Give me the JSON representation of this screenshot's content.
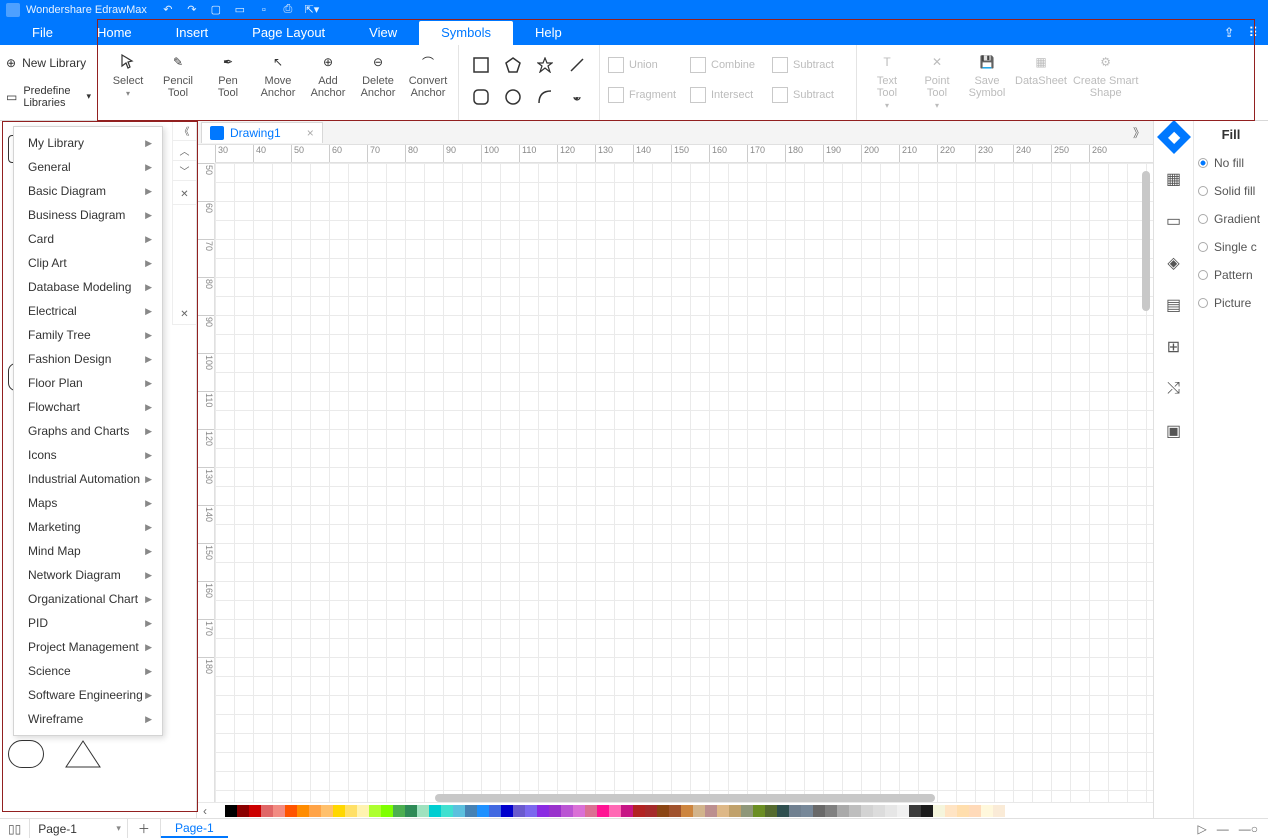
{
  "app": {
    "title": "Wondershare EdrawMax"
  },
  "menu": {
    "file": "File",
    "home": "Home",
    "insert": "Insert",
    "pageLayout": "Page Layout",
    "view": "View",
    "symbols": "Symbols",
    "help": "Help"
  },
  "ribbonLeft": {
    "newLibrary": "New Library",
    "predefine": "Predefine Libraries"
  },
  "ribbon": {
    "select": "Select",
    "pencil": "Pencil\nTool",
    "pen": "Pen\nTool",
    "moveAnchor": "Move\nAnchor",
    "addAnchor": "Add\nAnchor",
    "deleteAnchor": "Delete\nAnchor",
    "convertAnchor": "Convert\nAnchor",
    "union": "Union",
    "combine": "Combine",
    "subtract1": "Subtract",
    "fragment": "Fragment",
    "intersect": "Intersect",
    "subtract2": "Subtract",
    "textTool": "Text\nTool",
    "pointTool": "Point\nTool",
    "saveSymbol": "Save\nSymbol",
    "datasheet": "DataSheet",
    "smartShape": "Create Smart\nShape"
  },
  "libraryMenu": [
    "My Library",
    "General",
    "Basic Diagram",
    "Business Diagram",
    "Card",
    "Clip Art",
    "Database Modeling",
    "Electrical",
    "Family Tree",
    "Fashion Design",
    "Floor Plan",
    "Flowchart",
    "Graphs and Charts",
    "Icons",
    "Industrial Automation",
    "Maps",
    "Marketing",
    "Mind Map",
    "Network Diagram",
    "Organizational Chart",
    "PID",
    "Project Management",
    "Science",
    "Software Engineering",
    "Wireframe"
  ],
  "drawingTab": "Drawing1",
  "rulerH": [
    "30",
    "40",
    "50",
    "60",
    "70",
    "80",
    "90",
    "100",
    "110",
    "120",
    "130",
    "140",
    "150",
    "160",
    "170",
    "180",
    "190",
    "200",
    "210",
    "220",
    "230",
    "240",
    "250",
    "260"
  ],
  "rulerV": [
    "50",
    "60",
    "70",
    "80",
    "90",
    "100",
    "110",
    "120",
    "130",
    "140",
    "150",
    "160",
    "170",
    "180"
  ],
  "fill": {
    "title": "Fill",
    "noFill": "No fill",
    "solid": "Solid fill",
    "gradient": "Gradient",
    "single": "Single c",
    "pattern": "Pattern",
    "picture": "Picture"
  },
  "status": {
    "pageSel": "Page-1",
    "activePage": "Page-1"
  },
  "colors": [
    "#fff",
    "#000",
    "#8b0000",
    "#c00",
    "#e06666",
    "#f28b82",
    "#ff5400",
    "#ff8c00",
    "#ffa347",
    "#ffc06b",
    "#ffd700",
    "#ffe066",
    "#fff3b0",
    "#adff2f",
    "#7fff00",
    "#4caf50",
    "#2e8b57",
    "#9fe2bf",
    "#00ced1",
    "#40e0d0",
    "#5bc0de",
    "#4682b4",
    "#1e90ff",
    "#4169e1",
    "#0000cd",
    "#6a5acd",
    "#7b68ee",
    "#8a2be2",
    "#9932cc",
    "#ba55d3",
    "#da70d6",
    "#db7093",
    "#ff1493",
    "#ff69b4",
    "#c71585",
    "#b22222",
    "#a52a2a",
    "#8b4513",
    "#a0522d",
    "#cd853f",
    "#d2b48c",
    "#bc8f8f",
    "#deb887",
    "#c0a16b",
    "#8f9779",
    "#6b8e23",
    "#556b2f",
    "#2f4f4f",
    "#708090",
    "#778899",
    "#696969",
    "#808080",
    "#a9a9a9",
    "#bebebe",
    "#d3d3d3",
    "#dcdcdc",
    "#e6e6e6",
    "#f0f0f0",
    "#3b3b3b",
    "#1c1c1c",
    "#f5f5dc",
    "#ffe4c4",
    "#ffdead",
    "#ffdab9",
    "#fff8dc",
    "#faebd7"
  ]
}
